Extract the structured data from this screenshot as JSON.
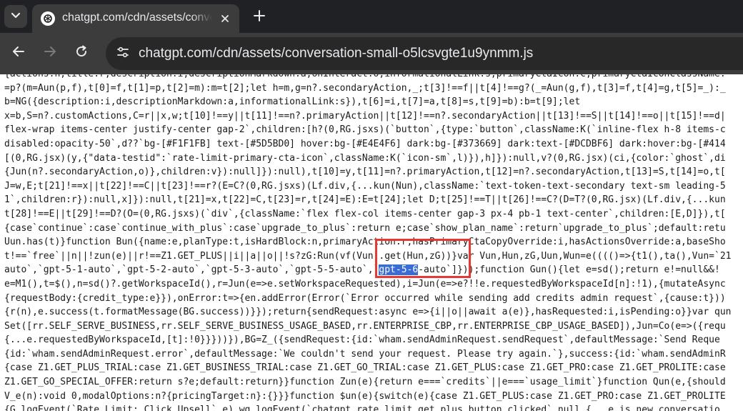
{
  "tab": {
    "title": "chatgpt.com/cdn/assets/conversation-small-o5lcsvgte1u9ynmm.js",
    "favicon": "openai-logo-icon"
  },
  "address_bar": {
    "url": "chatgpt.com/cdn/assets/conversation-small-o5lcsvgte1u9ynmm.js"
  },
  "code_lines": [
    "{actions:n,title:r,description:i,descriptionMarkdown:a,onInteract:o,informationalLink:s,primaryCtaIcon:c,primaryCtaIconClassName:",
    "=p?(m=Aun(p,f),t[0]=f,t[1]=p,t[2]=m):m=t[2];let h=m,g=n?.secondaryAction,_;t[3]!==f||t[4]!==g?(_=Aun(g,f),t[3]=f,t[4]=g,t[5]=_):_",
    "b=NG({description:i,descriptionMarkdown:a,informationalLink:s}),t[6]=i,t[7]=a,t[8]=s,t[9]=b):b=t[9];let",
    "x=b,S=n?.customActions,C=r||x,w;t[10]!==y||t[11]!==n?.primaryAction||t[12]!==n?.secondaryAction||t[13]!==S||t[14]!==o||t[15]!==d|",
    "flex-wrap items-center justify-center gap-2`,children:[h?(0,RG.jsxs)(`button`,{type:`button`,className:K(`inline-flex h-8 items-c",
    "disabled:opacity-50`,d??`bg-[#F1F1FB] text-[#5D5BD0] hover:bg-[#E4E4F6] dark:bg-[#373669] dark:text-[#DCDBF6] dark:hover:bg-[#414",
    "[(0,RG.jsx)(y,{\"data-testid\":`rate-limit-primary-cta-icon`,className:K(`icon-sm`,l)}),h]}):null,v?(0,RG.jsx)(ci,{color:`ghost`,di",
    "{Jun(n?.secondaryAction,o)},children:v}):null]}):null),t[10]=y,t[11]=n?.primaryAction,t[12]=n?.secondaryAction,t[13]=S,t[14]=o,t[",
    "J=w,E;t[21]!==x||t[22]!==C||t[23]!==r?(E=C?(0,RG.jsxs)(Lf.div,{...kun(Nun),className:`text-token-text-secondary text-sm leading-5",
    "1`,children:r}):null,x]}):null,t[21]=x,t[22]=C,t[23]=r,t[24]=E):E=t[24];let D;t[25]!==T||t[26]!==C?(D=T?(0,RG.jsx)(Lf.div,{...kun",
    "t[28]!==E||t[29]!==D?(O=(0,RG.jsxs)(`div`,{className:`flex flex-col items-center gap-3 px-4 pb-1 text-center`,children:[E,D]}),t[",
    "{case`continue`:case`continue_with_plus`:case`upgrade_to_plus`:return e;case`show_plan_name`:return`upgrade_to_plus`;default:retu",
    "Uun.has(t)}function Bun({name:e,planType:t,isHardBlock:n,primaryAction:r,hasPrimaryCtaCopyOverride:i,hasActionsOverride:a,baseSho",
    "t!==`free`||n||!zun(e)||r!==Z1.GET_PLUS||i||a||o||!s?zG:Run(vf(Vun).get(Hun,zG))}var Vun,Hun,zG,Uun,Wun=e(((()=>{t1(),ta(),Vun=`21",
    "auto`,`gpt-5-1-auto`,`gpt-5-2-auto`,`gpt-5-3-auto`,`gpt-5-5-auto`,`gpt-5-6-auto`]}));function Gun(){let e=sd();return e!=null&&!",
    "e=M1(),t=$(),n=sd()?.getWorkspaceId(),r=Jun(e=>e.setWorkspaceRequested),i=Jun(e=>e?!!e.requestedByWorkspaceId[n]:!1),{mutateAsync",
    "{requestBody:{credit_type:e}}),onError:t=>{en.addError(Error(`Error occurred while sending add credits admin request`,{cause:t}))",
    "{r(n),e.success(t.formatMessage(BG.success))}});return{sendRequest:async e=>{i||o||await a(e)},hasRequested:i,isPending:o}}var qun",
    "Set([rr.SELF_SERVE_BUSINESS,rr.SELF_SERVE_BUSINESS_USAGE_BASED,rr.ENTERPRISE_CBP,rr.ENTERPRISE_CBP_USAGE_BASED]),Jun=Co(e=>({requ",
    "{...e.requestedByWorkspaceId,[t]:!0}}}))}),BG=Z_({sendRequest:{id:`wham.sendAdminRequest.sendRequest`,defaultMessage:`Send Reque",
    "{id:`wham.sendAdminRequest.error`,defaultMessage:`We couldn't send your request. Please try again.`},success:{id:`wham.sendAdminR",
    "{case Z1.GET_PLUS_TRIAL:case Z1.GET_BUSINESS_TRIAL:case Z1.GET_GO_TRIAL:case Z1.GET_PLUS:case Z1.GET_PRO:case Z1.GET_PROLITE:case",
    "Z1.GET_GO_SPECIAL_OFFER:return s?e;default:return}}function Zun(e){return e===`credits`||e===`usage_limit`}function Qun(e,{should",
    "V_e(n):void 0,modalOptions:n?{pricingTarget:n}:{}}}function $un(e){switch(e){case Z1.GET_PLUS:case Z1.GET_PRO:case Z1.GET_PROLITE",
    "{G.logEvent(`Rate Limit: Click Upsell`,e),wg.logEvent(`chatgpt_rate_limit_get_plus_button_clicked`,null,{...e,is_new_conversatio",
    "e.is_new_conversation.toString():``,is_hard_block:e.is_hard_block.toString()})}function VG(e){G.logEvent(`Rate Limit: Click Upsel"
  ],
  "selection": {
    "line_before": "auto`,`gpt-5-1-auto`,`gpt-5-2-auto`,`gpt-5-3-auto`,`gpt-5-5-auto`,`",
    "text": "gpt-5-6",
    "line_after": "-auto`]}));function Gun(){let e=sd();return e!=null&&!"
  },
  "colors": {
    "highlight_box": "#e53935",
    "selection_bg": "#3a6cd6"
  }
}
